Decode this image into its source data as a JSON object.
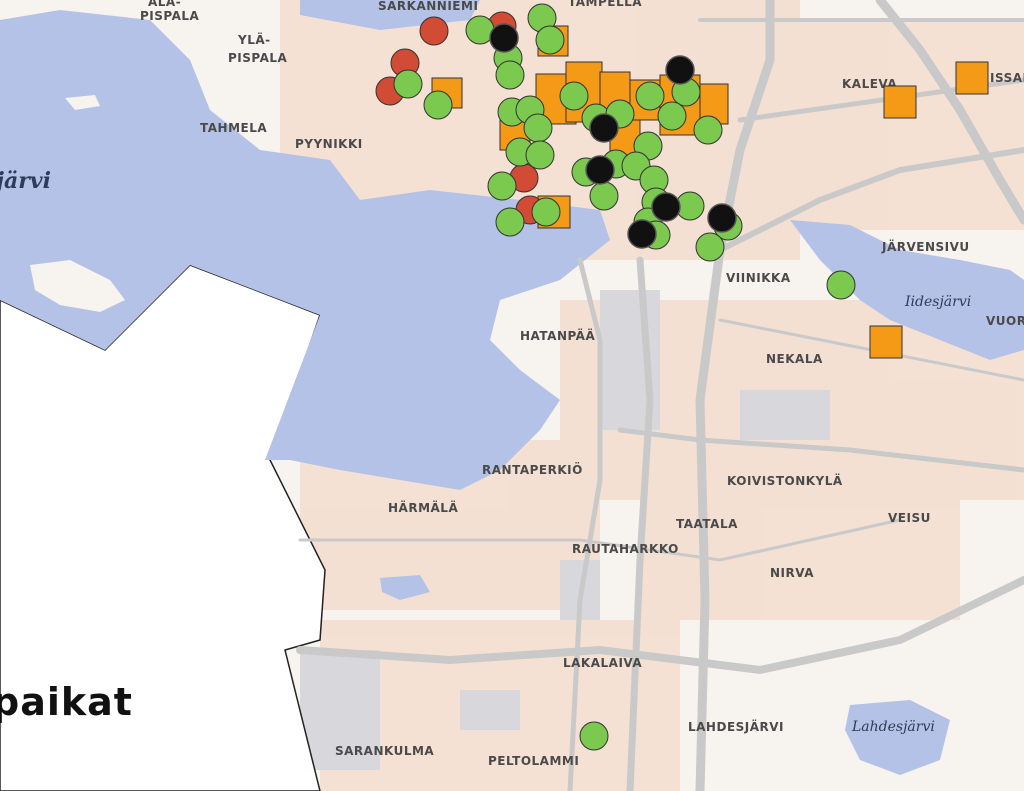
{
  "map": {
    "title": "paikat",
    "districts": [
      {
        "id": "ala-pispala-1",
        "label": "ALA-"
      },
      {
        "id": "ala-pispala-2",
        "label": "PISPALA"
      },
      {
        "id": "yla-pispala-1",
        "label": "YLÄ-"
      },
      {
        "id": "yla-pispala-2",
        "label": "PISPALA"
      },
      {
        "id": "sarkanniemi",
        "label": "SÄRKÄNNIEMI"
      },
      {
        "id": "tampella",
        "label": "TAMPELLA"
      },
      {
        "id": "tahmela",
        "label": "TAHMELA"
      },
      {
        "id": "pyynikki",
        "label": "PYYNIKKI"
      },
      {
        "id": "kaleva",
        "label": "KALEVA"
      },
      {
        "id": "kissanmaa",
        "label": "ISSAN"
      },
      {
        "id": "jarvensivu",
        "label": "JÄRVENSIVU"
      },
      {
        "id": "viinikka",
        "label": "VIINIKKA"
      },
      {
        "id": "vuores",
        "label": "VUOR"
      },
      {
        "id": "hatanpaa",
        "label": "HATANPÄÄ"
      },
      {
        "id": "nekala",
        "label": "NEKALA"
      },
      {
        "id": "rantaperkio",
        "label": "RANTAPERKIÖ"
      },
      {
        "id": "koivistonkyla",
        "label": "KOIVISTONKYLÄ"
      },
      {
        "id": "harmala",
        "label": "HÄRMÄLÄ"
      },
      {
        "id": "veisu",
        "label": "VEISU"
      },
      {
        "id": "taatala",
        "label": "TAATALA"
      },
      {
        "id": "rautaharkko",
        "label": "RAUTAHARKKO"
      },
      {
        "id": "nirva",
        "label": "NIRVA"
      },
      {
        "id": "lakalaiva",
        "label": "LAKALAIVA"
      },
      {
        "id": "lahdesjarvi",
        "label": "LAHDESJÄRVI"
      },
      {
        "id": "sarankulma",
        "label": "SARANKULMA"
      },
      {
        "id": "peltolammi",
        "label": "PELTOLAMMI"
      }
    ],
    "lakes": [
      {
        "id": "pyhajarvi",
        "label": "järvi"
      },
      {
        "id": "iidesjarvi",
        "label": "Iidesjärvi"
      },
      {
        "id": "lahdesjarvi-lake",
        "label": "Lahdesjärvi"
      }
    ],
    "marker_colors": {
      "green": "#7cc94f",
      "red": "#d14b35",
      "black": "#111111",
      "orange": "#f59a17"
    }
  }
}
